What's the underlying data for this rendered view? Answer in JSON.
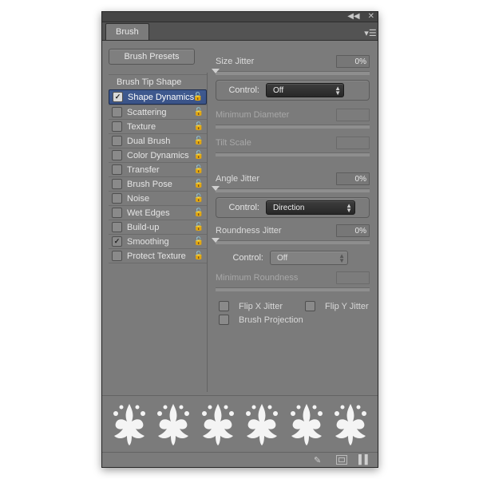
{
  "panel": {
    "title": "Brush",
    "presets_button": "Brush Presets",
    "tip_shape": "Brush Tip Shape",
    "options": [
      {
        "label": "Shape Dynamics",
        "checked": true,
        "lock": true,
        "selected": true
      },
      {
        "label": "Scattering",
        "checked": false,
        "lock": true,
        "selected": false
      },
      {
        "label": "Texture",
        "checked": false,
        "lock": true,
        "selected": false
      },
      {
        "label": "Dual Brush",
        "checked": false,
        "lock": true,
        "selected": false
      },
      {
        "label": "Color Dynamics",
        "checked": false,
        "lock": true,
        "selected": false
      },
      {
        "label": "Transfer",
        "checked": false,
        "lock": true,
        "selected": false
      },
      {
        "label": "Brush Pose",
        "checked": false,
        "lock": true,
        "selected": false
      },
      {
        "label": "Noise",
        "checked": false,
        "lock": true,
        "selected": false
      },
      {
        "label": "Wet Edges",
        "checked": false,
        "lock": true,
        "selected": false
      },
      {
        "label": "Build-up",
        "checked": false,
        "lock": true,
        "selected": false
      },
      {
        "label": "Smoothing",
        "checked": true,
        "lock": true,
        "selected": false
      },
      {
        "label": "Protect Texture",
        "checked": false,
        "lock": true,
        "selected": false
      }
    ]
  },
  "settings": {
    "size_jitter": {
      "label": "Size Jitter",
      "value": "0%"
    },
    "size_control": {
      "label": "Control:",
      "value": "Off"
    },
    "min_diameter": {
      "label": "Minimum Diameter"
    },
    "tilt_scale": {
      "label": "Tilt Scale"
    },
    "angle_jitter": {
      "label": "Angle Jitter",
      "value": "0%"
    },
    "angle_control": {
      "label": "Control:",
      "value": "Direction"
    },
    "roundness_jitter": {
      "label": "Roundness Jitter",
      "value": "0%"
    },
    "roundness_control": {
      "label": "Control:",
      "value": "Off"
    },
    "min_roundness": {
      "label": "Minimum Roundness"
    },
    "flip_x": {
      "label": "Flip X Jitter"
    },
    "flip_y": {
      "label": "Flip Y Jitter"
    },
    "brush_projection": {
      "label": "Brush Projection"
    }
  }
}
